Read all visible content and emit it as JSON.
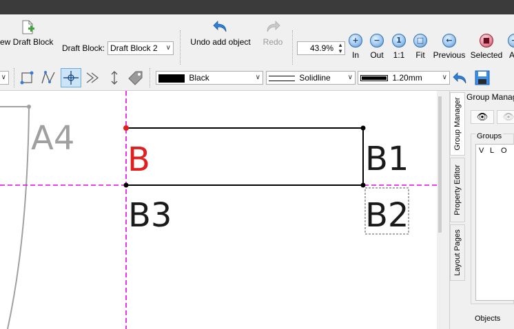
{
  "toolbar": {
    "new_draft_block_label": "ew Draft Block",
    "draft_block_label": "Draft Block:",
    "draft_block_value": "Draft Block 2",
    "undo_label": "Undo add object",
    "redo_label": "Redo",
    "zoom_value": "43.9%",
    "zoom_in_label": "In",
    "zoom_out_label": "Out",
    "zoom_1_1_label": "1:1",
    "zoom_fit_label": "Fit",
    "zoom_previous_label": "Previous",
    "zoom_selected_label": "Selected",
    "zoom_next_label": "A"
  },
  "properties": {
    "color_value": "Black",
    "color_swatch": "#000000",
    "line_type_value": "Solidline",
    "line_weight_value": "1.20mm"
  },
  "canvas": {
    "point_labels": [
      {
        "text": "A4",
        "color": "#a0a0a0"
      },
      {
        "text": "B",
        "color": "#e0201e"
      },
      {
        "text": "B1",
        "color": "#1a1a1a"
      },
      {
        "text": "B2",
        "color": "#1a1a1a"
      },
      {
        "text": "B3",
        "color": "#1a1a1a"
      }
    ],
    "guide_color": "#e800e8"
  },
  "side_tabs": [
    "Group Manager",
    "Property Editor",
    "Layout Pages"
  ],
  "group_manager": {
    "title": "Group Manag",
    "groups_label": "Groups",
    "columns": [
      "V",
      "L",
      "O"
    ],
    "objects_label": "Objects"
  }
}
